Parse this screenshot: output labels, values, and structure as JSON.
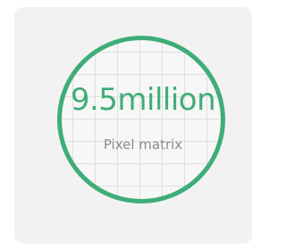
{
  "stat": {
    "value": "9.5million",
    "caption": "Pixel matrix"
  },
  "colors": {
    "accent": "#3fad78",
    "caption": "#8c8c8c",
    "card_background": "#f2f2f2",
    "grid_lines": "#dedede"
  }
}
